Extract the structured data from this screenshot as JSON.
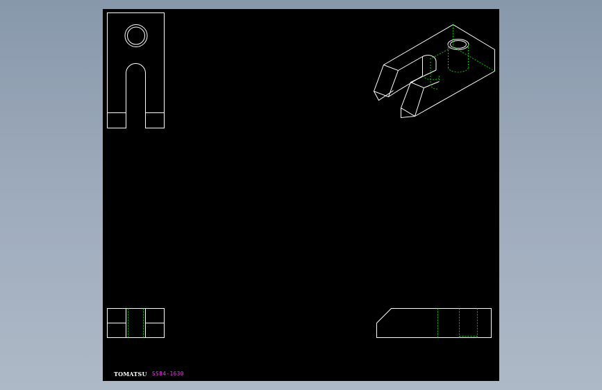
{
  "title_block": {
    "brand": "TOMATSU",
    "part_code": "SS84-1630"
  },
  "colors": {
    "background": "#000000",
    "visible_line": "#ffffff",
    "hidden_line": "#00c800",
    "part_code": "#ff33ff",
    "frame_gradient_top": "#8898ab",
    "frame_gradient_bottom": "#aeb9c7"
  },
  "views": [
    "front-view",
    "top-view",
    "side-view",
    "isometric-view"
  ]
}
